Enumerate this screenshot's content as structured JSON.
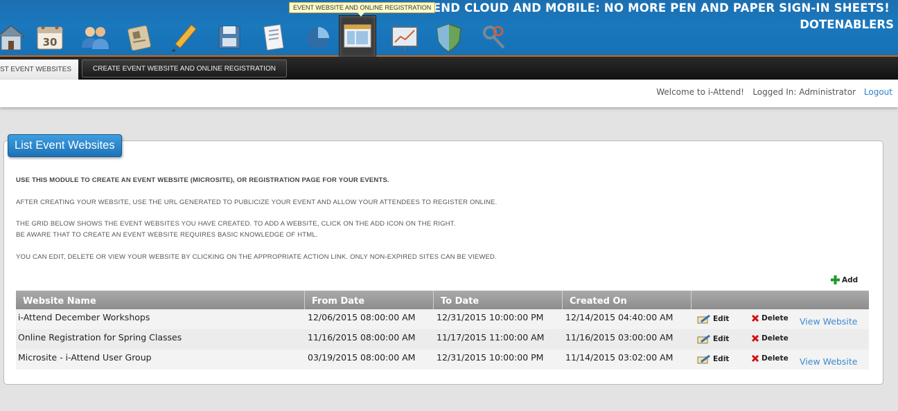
{
  "banner": {
    "title": "I-ATTEND CLOUD AND MOBILE: NO MORE PEN AND PAPER SIGN-IN SHEETS!",
    "subtitle": "DOTENABLERS",
    "tooltip": "EVENT WEBSITE AND ONLINE REGISTRATION",
    "icons": [
      "home-icon",
      "calendar-icon",
      "users-icon",
      "id-badge-icon",
      "pencil-icon",
      "save-disk-icon",
      "document-icon",
      "pie-chart-icon",
      "website-icon",
      "presentation-board-icon",
      "shield-icon",
      "keys-icon"
    ],
    "active_icon": "website-icon",
    "calendar_day": "30"
  },
  "tabs": {
    "list_label": "LIST EVENT WEBSITES",
    "create_label": "CREATE EVENT WEBSITE AND ONLINE REGISTRATION"
  },
  "user": {
    "welcome": "Welcome to i-Attend!",
    "logged_in": "Logged In: Administrator",
    "logout": "Logout"
  },
  "panel": {
    "title": "List Event Websites",
    "instructions": [
      "USE THIS MODULE TO CREATE AN EVENT WEBSITE (MICROSITE), OR REGISTRATION PAGE FOR YOUR EVENTS.",
      "AFTER CREATING YOUR WEBSITE, USE THE URL GENERATED TO PUBLICIZE YOUR EVENT AND ALLOW YOUR ATTENDEES TO REGISTER ONLINE.",
      "THE GRID BELOW SHOWS THE EVENT WEBSITES YOU HAVE CREATED. TO ADD A WEBSITE, CLICK ON THE ADD ICON ON THE RIGHT.",
      "BE AWARE THAT TO CREATE AN EVENT WEBSITE REQUIRES BASIC KNOWLEDGE OF HTML.",
      "YOU CAN EDIT, DELETE OR VIEW YOUR WEBSITE BY CLICKING ON THE APPROPRIATE ACTION LINK. ONLY NON-EXPIRED SITES CAN BE VIEWED."
    ],
    "add_label": "Add"
  },
  "grid": {
    "columns": [
      "Website Name",
      "From Date",
      "To Date",
      "Created On",
      ""
    ],
    "edit_label": "Edit",
    "delete_label": "Delete",
    "view_label": "View Website",
    "rows": [
      {
        "name": "i-Attend December Workshops",
        "from": "12/06/2015 08:00:00 AM",
        "to": "12/31/2015 10:00:00 PM",
        "created": "12/14/2015 04:40:00 AM",
        "view": "View Website"
      },
      {
        "name": "Online Registration for Spring Classes",
        "from": "11/16/2015 08:00:00 AM",
        "to": "11/17/2015 11:00:00 AM",
        "created": "11/16/2015 03:00:00 AM",
        "view": ""
      },
      {
        "name": "Microsite - i-Attend User Group",
        "from": "03/19/2015 08:00:00 AM",
        "to": "12/31/2015 10:00:00 PM",
        "created": "11/14/2015 03:02:00 AM",
        "view": "View Website"
      }
    ]
  },
  "colors": {
    "banner_blue": "#1a78bd",
    "header_blue": "#2a88cf",
    "link_blue": "#3d8ad0",
    "grid_header": "#9b9b9b",
    "add_green": "#1e9a2a",
    "delete_red": "#d01010"
  }
}
